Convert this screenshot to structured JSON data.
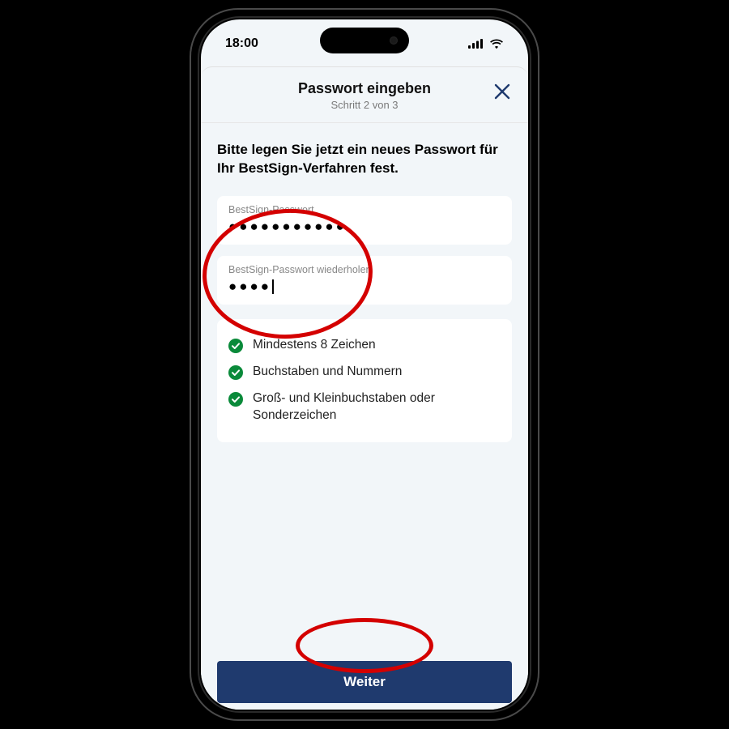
{
  "status": {
    "time": "18:00"
  },
  "header": {
    "title": "Passwort eingeben",
    "step": "Schritt 2 von 3"
  },
  "instruction": "Bitte legen Sie jetzt ein neues Passwort für Ihr BestSign-Verfahren fest.",
  "fields": {
    "password": {
      "label": "BestSign-Passwort",
      "value": "●●●●●●●●●●●"
    },
    "repeat": {
      "label": "BestSign-Passwort wiederholen",
      "value": "●●●●"
    }
  },
  "rules": {
    "r1": "Mindestens 8 Zeichen",
    "r2": "Buchstaben und Nummern",
    "r3": "Groß- und Kleinbuchstaben oder Sonderzeichen"
  },
  "cta": "Weiter",
  "colors": {
    "primary": "#1f3a6e",
    "annotation": "#d40000",
    "success": "#0a8a3a"
  }
}
